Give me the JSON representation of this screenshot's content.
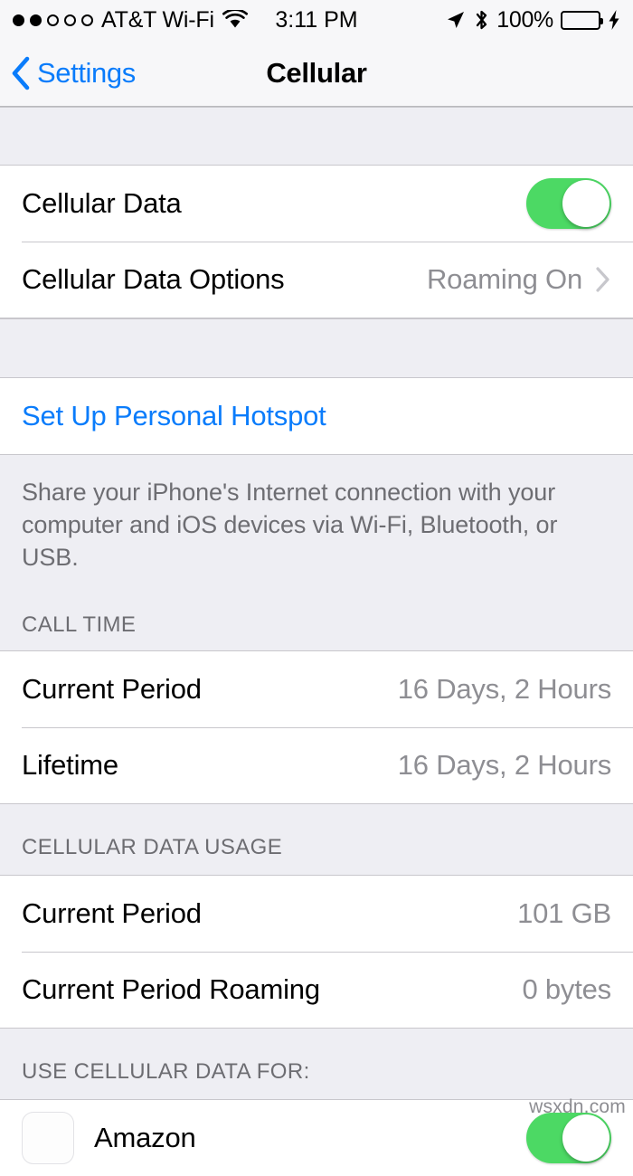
{
  "status_bar": {
    "signal_dots_total": 5,
    "signal_dots_filled": 2,
    "carrier": "AT&T Wi-Fi",
    "wifi_icon": "wifi-icon",
    "time": "3:11 PM",
    "location_icon": "location-arrow-icon",
    "bluetooth_icon": "bluetooth-icon",
    "battery_percent": "100%",
    "battery_icon": "battery-icon",
    "charging_icon": "lightning-bolt-icon",
    "battery_color": "#4cd964"
  },
  "nav_bar": {
    "back_icon": "chevron-left-icon",
    "back_label": "Settings",
    "title": "Cellular",
    "tint_color": "#0a7cfb"
  },
  "sections": {
    "cellular_data": {
      "rows": [
        {
          "label": "Cellular Data",
          "control": "toggle",
          "toggle_on": true,
          "toggle_color": "#4cd964"
        },
        {
          "label": "Cellular Data Options",
          "value": "Roaming On",
          "control": "disclosure",
          "chevron_icon": "chevron-right-icon"
        }
      ]
    },
    "hotspot": {
      "link_label": "Set Up Personal Hotspot",
      "note": "Share your iPhone's Internet connection with your computer and iOS devices via Wi-Fi, Bluetooth, or USB."
    },
    "call_time": {
      "header": "CALL TIME",
      "rows": [
        {
          "label": "Current Period",
          "value": "16 Days, 2 Hours"
        },
        {
          "label": "Lifetime",
          "value": "16 Days, 2 Hours"
        }
      ]
    },
    "data_usage": {
      "header": "CELLULAR DATA USAGE",
      "rows": [
        {
          "label": "Current Period",
          "value": "101 GB"
        },
        {
          "label": "Current Period Roaming",
          "value": "0 bytes"
        }
      ]
    },
    "use_cellular_data_for": {
      "header": "USE CELLULAR DATA FOR:",
      "apps": [
        {
          "name": "Amazon",
          "icon": "amazon-app-icon",
          "toggle_on": true,
          "toggle_color": "#4cd964"
        }
      ]
    }
  },
  "watermark": "wsxdn.com"
}
